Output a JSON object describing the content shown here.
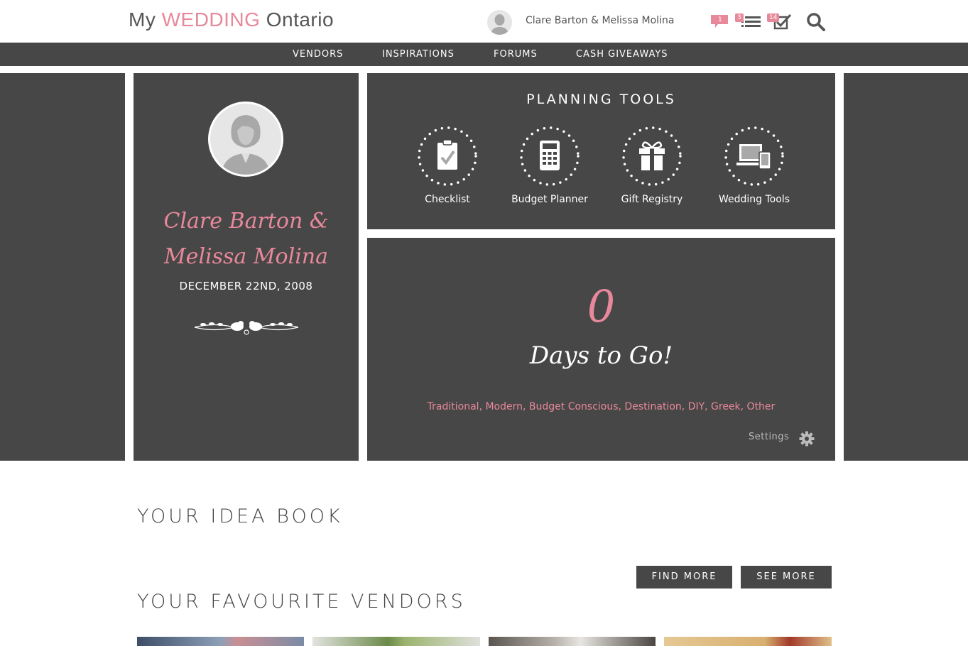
{
  "header": {
    "logo": {
      "prefix": "My ",
      "accent": "WEDDING",
      "suffix": " Ontario"
    },
    "user_name": "Clare Barton & Melissa Molina",
    "badges": {
      "messages": "1",
      "lists": "3",
      "tasks": "14"
    },
    "icons": [
      "chat-icon",
      "list-icon",
      "checklist-icon",
      "search-icon"
    ]
  },
  "nav": {
    "items": [
      "VENDORS",
      "INSPIRATIONS",
      "FORUMS",
      "CASH GIVEAWAYS"
    ]
  },
  "profile": {
    "couple_name": "Clare Barton & Melissa Molina",
    "date": "DECEMBER 22ND, 2008"
  },
  "planning_tools": {
    "title": "PLANNING TOOLS",
    "tools": [
      {
        "label": "Checklist",
        "icon": "clipboard-icon"
      },
      {
        "label": "Budget Planner",
        "icon": "calculator-icon"
      },
      {
        "label": "Gift Registry",
        "icon": "gift-icon"
      },
      {
        "label": "Wedding Tools",
        "icon": "devices-icon"
      }
    ]
  },
  "countdown": {
    "days": "0",
    "label": "Days to Go!",
    "styles": "Traditional, Modern, Budget Conscious, Destination, DIY, Greek, Other",
    "settings_label": "Settings"
  },
  "idea_book": {
    "title": "YOUR IDEA BOOK"
  },
  "vendors": {
    "title": "YOUR FAVOURITE VENDORS",
    "find_more": "FIND MORE",
    "see_more": "SEE MORE"
  },
  "colors": {
    "accent": "#e8889b",
    "dark_panel": "#474747",
    "nav": "#474747"
  }
}
